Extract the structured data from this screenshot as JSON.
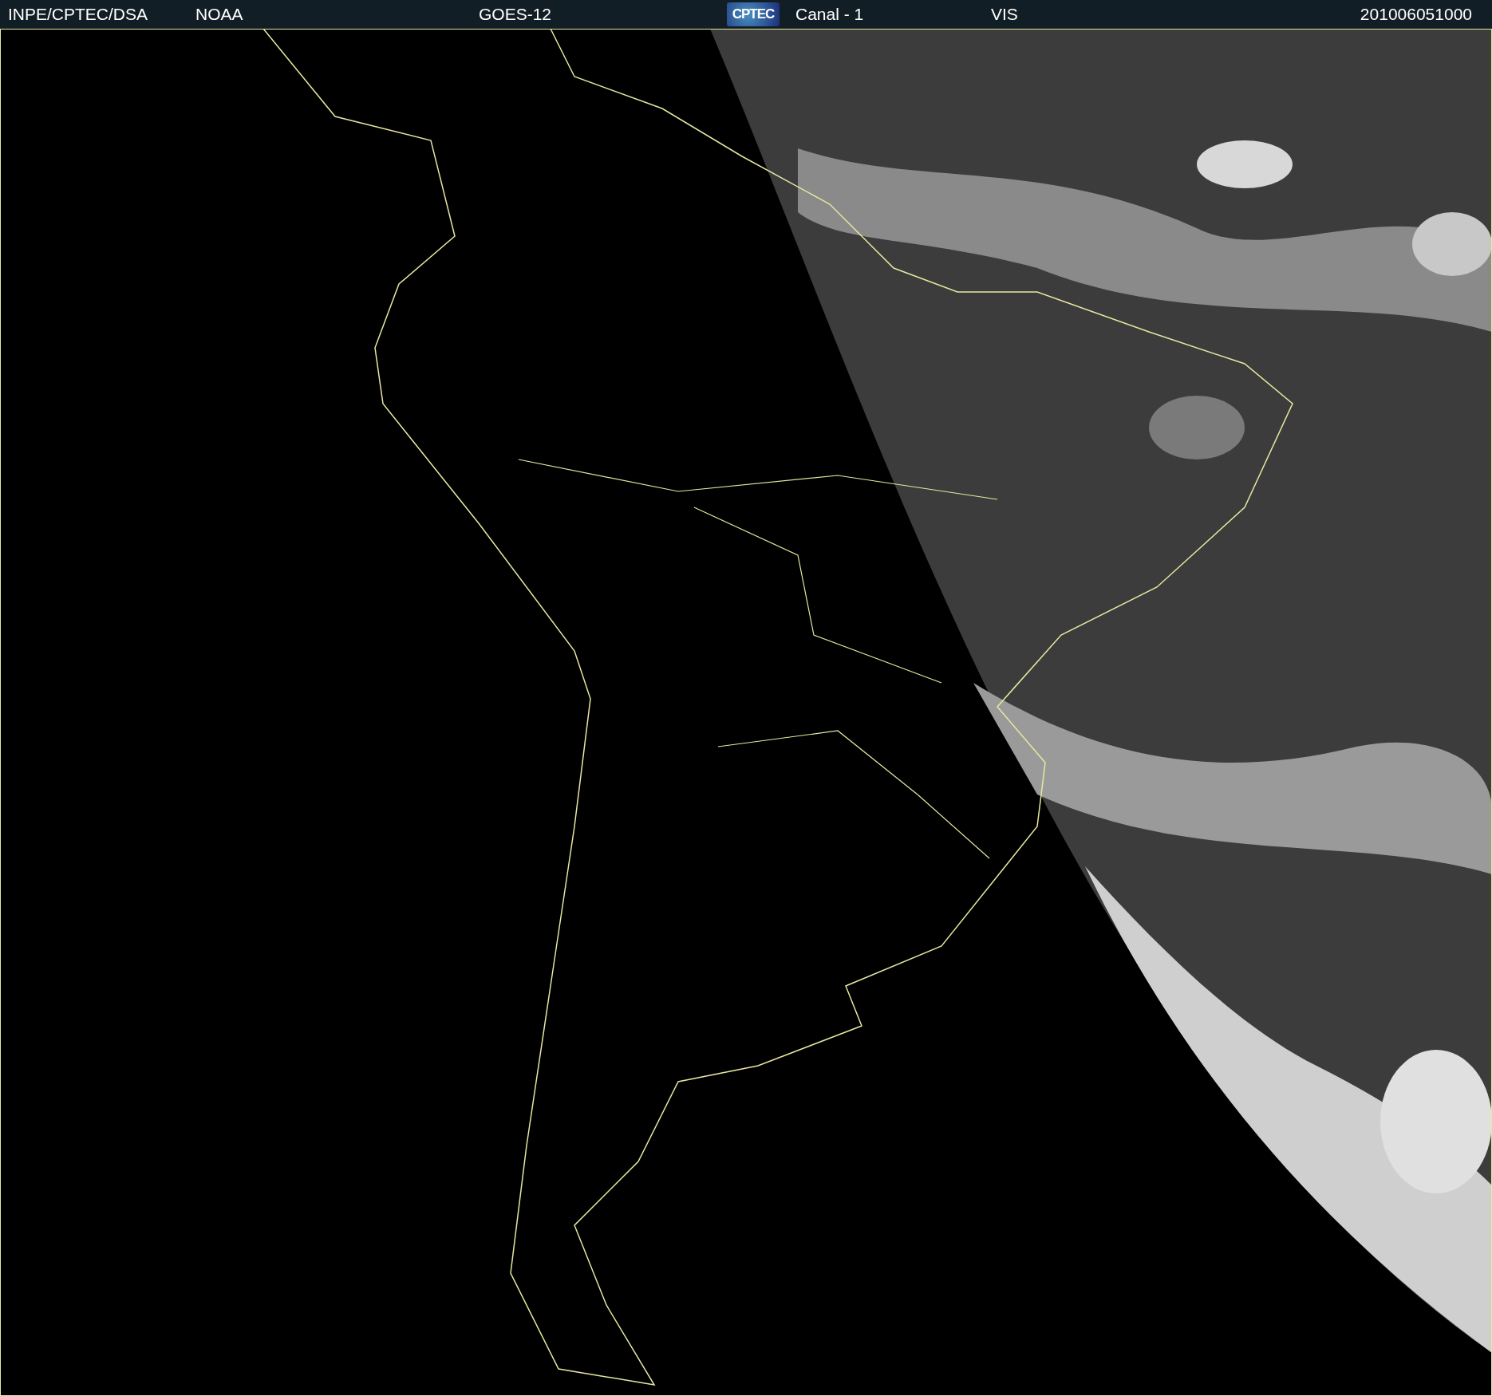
{
  "header": {
    "source": "INPE/CPTEC/DSA",
    "agency": "NOAA",
    "satellite": "GOES-12",
    "logo": "CPTEC",
    "channel": "Canal - 1",
    "band": "VIS",
    "timestamp": "201006051000"
  }
}
